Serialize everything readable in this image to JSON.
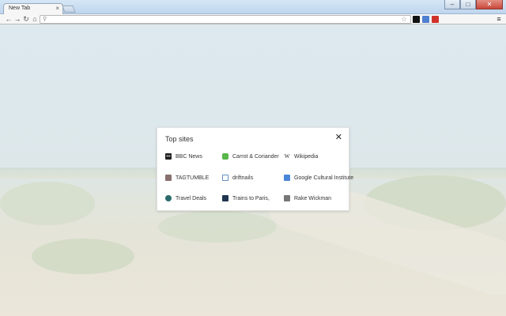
{
  "browser": {
    "tab_title": "New Tab",
    "tab_close": "×",
    "omnibox_value": "",
    "window_buttons": [
      "–",
      "□",
      "✕"
    ]
  },
  "top_sites": {
    "title": "Top sites",
    "close": "✕",
    "sites": [
      {
        "label": "BBC News",
        "icon": "bbc-icon",
        "color": "#222222"
      },
      {
        "label": "Carrot & Coriander",
        "icon": "carrot-coriander-icon",
        "color": "#59b64a"
      },
      {
        "label": "Wikipedia",
        "icon": "wikipedia-icon",
        "color": "#ffffff"
      },
      {
        "label": "TAGTUMBLE",
        "icon": "tagtumble-icon",
        "color": "#8a6f6f"
      },
      {
        "label": "driftnails",
        "icon": "driftnails-icon",
        "color": "#5f8fc7"
      },
      {
        "label": "Google Cultural Institute",
        "icon": "google-cultural-icon",
        "color": "#4a86d8"
      },
      {
        "label": "Travel Deals",
        "icon": "travel-deals-icon",
        "color": "#2a6b6b"
      },
      {
        "label": "Trains to Paris,",
        "icon": "trains-icon",
        "color": "#1f3550"
      },
      {
        "label": "Rake Wickman",
        "icon": "rake-wickman-icon",
        "color": "#777777"
      }
    ]
  }
}
